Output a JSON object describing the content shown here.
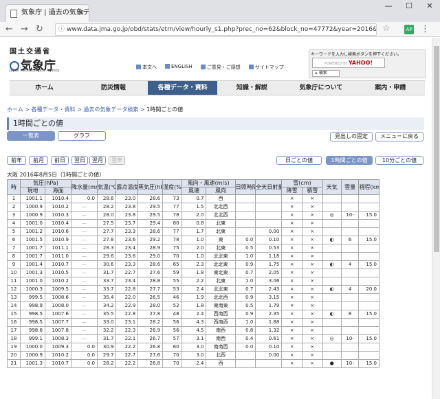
{
  "browser": {
    "tab_title": "気象庁 | 過去の気象デー",
    "url": "www.data.jma.go.jp/obd/stats/etrn/view/hourly_s1.php?prec_no=62&block_no=47772&year=2016&month=08&day=",
    "ext_label": "AP"
  },
  "header": {
    "mlit": "国土交通省",
    "jma": "気象庁",
    "jma_en": "Japan Meteorological Agency",
    "links": [
      "本文へ",
      "ENGLISH",
      "ご意見・ご感想",
      "サイトマップ"
    ],
    "search_hint": "キーワードを入力し検索ボタンを押下ください。",
    "search_powered": "POWERED BY",
    "search_brand": "YAHOO!",
    "search_button": "検索"
  },
  "gnav": [
    "ホーム",
    "防災情報",
    "各種データ・資料",
    "知識・解説",
    "気象庁について",
    "案内・申請"
  ],
  "breadcrumb": [
    "ホーム",
    "各種データ・資料",
    "過去の気象データ検索",
    "1時間ごとの値"
  ],
  "page_title": "1時間ごとの値",
  "view_tabs": [
    "一覧表",
    "グラフ"
  ],
  "right_buttons": [
    "見出しの固定",
    "メニューに戻る"
  ],
  "date_nav": [
    "前年",
    "前月",
    "前日",
    "翌日",
    "翌月",
    "翌年"
  ],
  "period_buttons": [
    "日ごとの値",
    "1時間ごとの値",
    "10分ごとの値"
  ],
  "caption": "大阪 2016年8月5日（1時間ごとの値）",
  "table": {
    "h_time": "時",
    "h_pressure": "気圧(hPa)",
    "h_pressure_site": "現地",
    "h_pressure_sea": "海面",
    "h_precip": "降水量(mm)",
    "h_temp": "気温(℃)",
    "h_dew": "露点温度(℃)",
    "h_vapor": "蒸気圧(hPa)",
    "h_humid": "湿度(%)",
    "h_wind": "風向・風速(m/s)",
    "h_wind_speed": "風速",
    "h_wind_dir": "風向",
    "h_sun": "日照時間(h)",
    "h_rad": "全天日射量(MJ/m²)",
    "h_snow": "雪(cm)",
    "h_snow_fall": "降雪",
    "h_snow_depth": "積雪",
    "h_weather": "天気",
    "h_cloud": "雲量",
    "h_vis": "視程(km)",
    "rows": [
      [
        "1",
        "1001.1",
        "1010.4",
        "0.0",
        "28.6",
        "23.0",
        "28.6",
        "73",
        "0.7",
        "西",
        "",
        "",
        "×",
        "×",
        "",
        "",
        ""
      ],
      [
        "2",
        "1000.9",
        "1010.2",
        "—",
        "28.2",
        "23.8",
        "29.5",
        "77",
        "1.5",
        "北北西",
        "",
        "",
        "×",
        "×",
        "",
        "",
        ""
      ],
      [
        "3",
        "1000.9",
        "1010.3",
        "—",
        "28.0",
        "23.8",
        "29.5",
        "78",
        "2.0",
        "北北西",
        "",
        "",
        "×",
        "×",
        "◎",
        "10-",
        "15.0"
      ],
      [
        "4",
        "1001.0",
        "1010.4",
        "—",
        "27.5",
        "23.7",
        "29.4",
        "80",
        "0.8",
        "北東",
        "",
        "",
        "×",
        "×",
        "",
        "",
        ""
      ],
      [
        "5",
        "1001.2",
        "1010.6",
        "—",
        "27.7",
        "23.3",
        "28.6",
        "77",
        "1.7",
        "北東",
        "",
        "0.00",
        "×",
        "×",
        "",
        "",
        ""
      ],
      [
        "6",
        "1001.5",
        "1010.9",
        "—",
        "27.8",
        "23.6",
        "29.2",
        "78",
        "1.0",
        "東",
        "0.0",
        "0.10",
        "×",
        "×",
        "◐",
        "6",
        "15.0"
      ],
      [
        "7",
        "1001.7",
        "1011.1",
        "—",
        "28.3",
        "23.4",
        "28.9",
        "75",
        "2.0",
        "北東",
        "0.5",
        "0.53",
        "×",
        "×",
        "",
        "",
        ""
      ],
      [
        "8",
        "1001.7",
        "1011.0",
        "—",
        "29.6",
        "23.6",
        "29.0",
        "70",
        "1.0",
        "北北東",
        "1.0",
        "1.18",
        "×",
        "×",
        "",
        "",
        ""
      ],
      [
        "9",
        "1001.4",
        "1010.7",
        "—",
        "30.6",
        "23.3",
        "28.6",
        "65",
        "2.3",
        "北北東",
        "0.9",
        "1.75",
        "×",
        "×",
        "◐",
        "4",
        "15.0"
      ],
      [
        "10",
        "1001.3",
        "1010.5",
        "—",
        "31.7",
        "22.7",
        "27.6",
        "59",
        "1.8",
        "東北東",
        "0.7",
        "2.05",
        "×",
        "×",
        "",
        "",
        ""
      ],
      [
        "11",
        "1001.0",
        "1010.2",
        "—",
        "33.7",
        "23.4",
        "28.8",
        "55",
        "2.2",
        "北東",
        "1.0",
        "3.06",
        "×",
        "×",
        "",
        "",
        ""
      ],
      [
        "12",
        "1000.3",
        "1009.5",
        "—",
        "33.7",
        "22.8",
        "27.7",
        "53",
        "2.4",
        "北北東",
        "0.7",
        "2.43",
        "×",
        "×",
        "◐",
        "4",
        "20.0"
      ],
      [
        "13",
        "999.5",
        "1008.6",
        "—",
        "35.4",
        "22.0",
        "26.5",
        "46",
        "1.9",
        "北北西",
        "0.9",
        "3.15",
        "×",
        "×",
        "",
        "",
        ""
      ],
      [
        "14",
        "998.9",
        "1008.0",
        "—",
        "34.2",
        "22.9",
        "28.0",
        "52",
        "1.8",
        "東南東",
        "0.5",
        "1.79",
        "×",
        "×",
        "",
        "",
        ""
      ],
      [
        "15",
        "998.5",
        "1007.6",
        "—",
        "35.5",
        "22.8",
        "27.8",
        "48",
        "2.4",
        "西南西",
        "0.9",
        "2.35",
        "×",
        "×",
        "◐",
        "8",
        "15.0"
      ],
      [
        "16",
        "998.5",
        "1007.7",
        "—",
        "33.0",
        "23.1",
        "28.2",
        "56",
        "4.3",
        "西南西",
        "1.0",
        "1.88",
        "×",
        "×",
        "",
        "",
        ""
      ],
      [
        "17",
        "998.6",
        "1007.8",
        "—",
        "32.2",
        "22.3",
        "26.9",
        "56",
        "4.5",
        "南西",
        "0.8",
        "1.32",
        "×",
        "×",
        "",
        "",
        ""
      ],
      [
        "18",
        "999.1",
        "1008.3",
        "—",
        "31.7",
        "22.1",
        "26.7",
        "57",
        "3.1",
        "南西",
        "0.4",
        "0.61",
        "×",
        "×",
        "◎",
        "10-",
        "15.0"
      ],
      [
        "19",
        "1000.0",
        "1009.3",
        "0.0",
        "30.9",
        "22.2",
        "26.8",
        "60",
        "3.0",
        "南南西",
        "0.0",
        "0.10",
        "×",
        "×",
        "",
        "",
        ""
      ],
      [
        "20",
        "1000.9",
        "1010.2",
        "0.0",
        "29.7",
        "22.7",
        "27.6",
        "70",
        "3.0",
        "北西",
        "",
        "0.00",
        "×",
        "×",
        "",
        "",
        ""
      ],
      [
        "21",
        "1001.3",
        "1010.7",
        "0.0",
        "28.2",
        "22.2",
        "26.8",
        "70",
        "2.4",
        "西",
        "",
        "",
        "×",
        "×",
        "●",
        "10-",
        "15.0"
      ]
    ]
  },
  "colors": {
    "nav_active": "#3e5f8a",
    "accent": "#7b95c7",
    "header_bg": "#dde3ef",
    "link": "#3a5ca8"
  }
}
